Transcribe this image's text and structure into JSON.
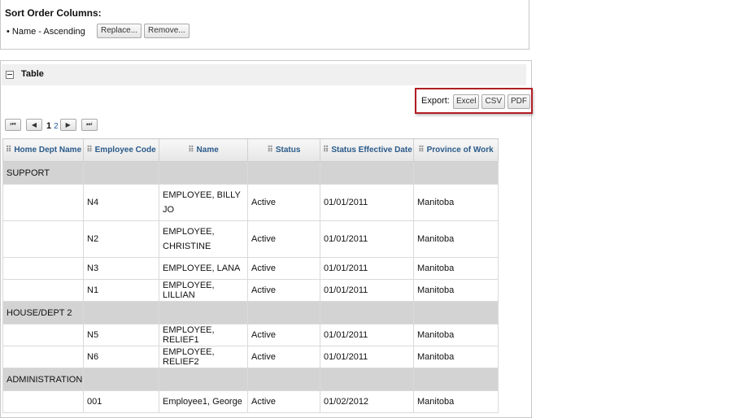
{
  "sort": {
    "title": "Sort Order Columns:",
    "item": "• Name - Ascending",
    "replace_label": "Replace...",
    "remove_label": "Remove..."
  },
  "panel": {
    "title": "Table",
    "collapse_icon": "minus-box-icon"
  },
  "export": {
    "label": "Export:",
    "excel": "Excel",
    "csv": "CSV",
    "pdf": "PDF"
  },
  "pager": {
    "first": "⏮",
    "prev": "◀",
    "current": "1",
    "page2": "2",
    "next": "▶",
    "last": "⏭"
  },
  "columns": [
    "Home Dept Name",
    "Employee Code",
    "Name",
    "Status",
    "Status Effective Date",
    "Province of Work"
  ],
  "groups": [
    {
      "name": "SUPPORT",
      "rows": [
        {
          "code": "N4",
          "name": "EMPLOYEE, BILLY JO",
          "status": "Active",
          "date": "01/01/2011",
          "province": "Manitoba"
        },
        {
          "code": "N2",
          "name": "EMPLOYEE, CHRISTINE",
          "status": "Active",
          "date": "01/01/2011",
          "province": "Manitoba"
        },
        {
          "code": "N3",
          "name": "EMPLOYEE, LANA",
          "status": "Active",
          "date": "01/01/2011",
          "province": "Manitoba"
        },
        {
          "code": "N1",
          "name": "EMPLOYEE, LILLIAN",
          "status": "Active",
          "date": "01/01/2011",
          "province": "Manitoba"
        }
      ]
    },
    {
      "name": "HOUSE/DEPT 2",
      "rows": [
        {
          "code": "N5",
          "name": "EMPLOYEE, RELIEF1",
          "status": "Active",
          "date": "01/01/2011",
          "province": "Manitoba"
        },
        {
          "code": "N6",
          "name": "EMPLOYEE, RELIEF2",
          "status": "Active",
          "date": "01/01/2011",
          "province": "Manitoba"
        }
      ]
    },
    {
      "name": "ADMINISTRATION",
      "rows": [
        {
          "code": "001",
          "name": "Employee1, George",
          "status": "Active",
          "date": "01/02/2012",
          "province": "Manitoba"
        }
      ]
    }
  ]
}
